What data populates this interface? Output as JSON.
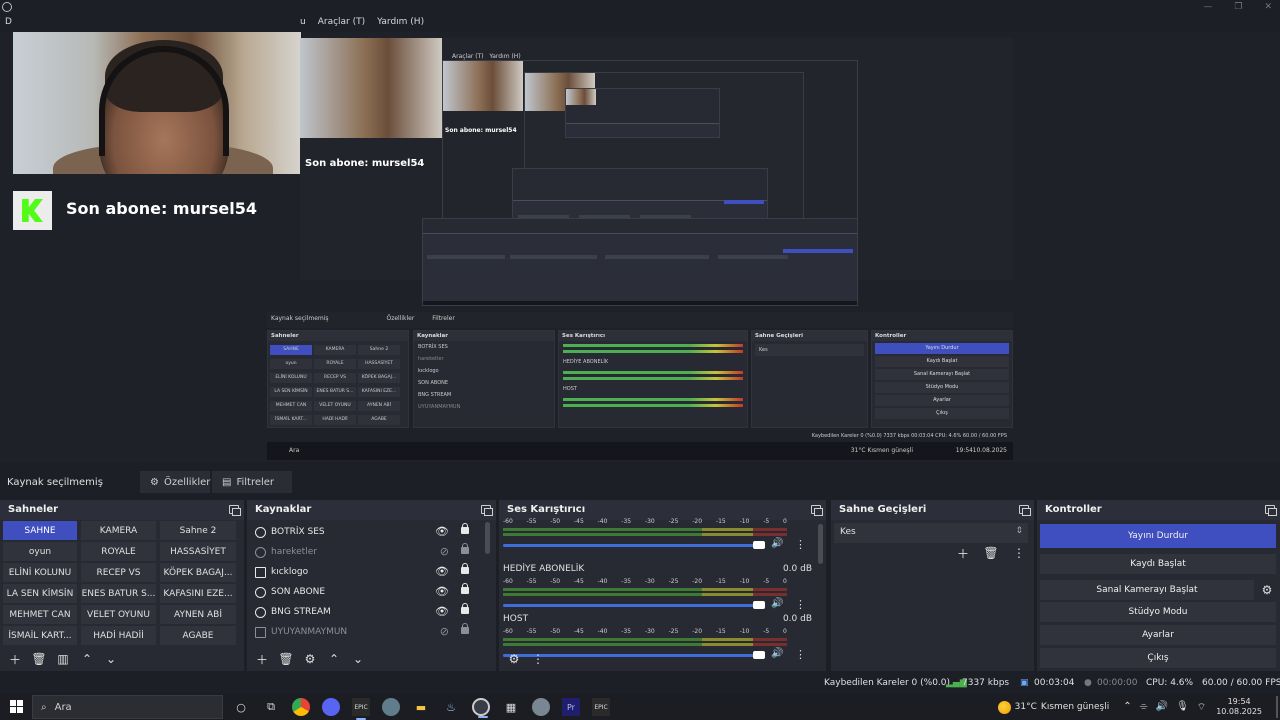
{
  "menu": {
    "left_fragment": "D",
    "fragment_u": "u",
    "items": [
      "Araçlar (T)",
      "Yardım (H)"
    ]
  },
  "preview": {
    "sub_alert": "Son abone: mursel54",
    "nested": {
      "menu_items": [
        "Araçlar (T)",
        "Yardım (H)"
      ],
      "strip_label": "Kaynak seçilmemiş",
      "props": "Özellikler",
      "filters": "Filtreler",
      "panels": {
        "scenes": "Sahneler",
        "sources": "Kaynaklar",
        "mixer": "Ses Karıştırıcı",
        "transitions": "Sahne Geçişleri",
        "controls": "Kontroller"
      },
      "transition": "Kes",
      "channels": [
        "HEDİYE ABONELİK",
        "HOST"
      ],
      "status": "Kaybedilen Kareler 0 (%0.0)   7337 kbps   00:03:04   CPU: 4.6%   60.00 / 60.00 FPS",
      "taskbar_search": "Ara",
      "weather": "31°C  Kısmen güneşli",
      "time": "19:54",
      "date": "10.08.2025"
    }
  },
  "toolbar": {
    "no_source": "Kaynak seçilmemiş",
    "properties": "Özellikler",
    "filters": "Filtreler"
  },
  "scenes": {
    "title": "Sahneler",
    "items": [
      "SAHNE",
      "KAMERA",
      "Sahne 2",
      "oyun",
      "ROYALE",
      "HASSASİYET",
      "ELİNİ KOLUNU",
      "RECEP VS",
      "KÖPEK BAGAJ...",
      "LA SEN KİMSİN",
      "ENES BATUR S...",
      "KAFASINI EZE...",
      "MEHMET CAN",
      "VELET OYUNU",
      "AYNEN ABİ",
      "İSMAİL KART...",
      "HADİ HADİİ",
      "AGABE"
    ],
    "active_index": 0
  },
  "sources": {
    "title": "Kaynaklar",
    "items": [
      {
        "name": "BOTRİX SES",
        "visible": true,
        "dim": false,
        "type": "browser"
      },
      {
        "name": "hareketler",
        "visible": false,
        "dim": true,
        "type": "browser"
      },
      {
        "name": "kıcklogo",
        "visible": true,
        "dim": false,
        "type": "image"
      },
      {
        "name": "SON ABONE",
        "visible": true,
        "dim": false,
        "type": "browser"
      },
      {
        "name": "BNG STREAM",
        "visible": true,
        "dim": false,
        "type": "browser"
      },
      {
        "name": "UYUYANMAYMUN",
        "visible": false,
        "dim": true,
        "type": "image"
      }
    ]
  },
  "mixer": {
    "title": "Ses Karıştırıcı",
    "scale": [
      "-60",
      "-55",
      "-50",
      "-45",
      "-40",
      "-35",
      "-30",
      "-25",
      "-20",
      "-15",
      "-10",
      "-5",
      "0"
    ],
    "channels": [
      {
        "name": "",
        "db": ""
      },
      {
        "name": "HEDİYE ABONELİK",
        "db": "0.0 dB"
      },
      {
        "name": "HOST",
        "db": "0.0 dB"
      }
    ]
  },
  "transitions": {
    "title": "Sahne Geçişleri",
    "selected": "Kes"
  },
  "controls": {
    "title": "Kontroller",
    "stop_stream": "Yayını Durdur",
    "start_record": "Kaydı Başlat",
    "virtual_cam": "Sanal Kamerayı Başlat",
    "studio_mode": "Stüdyo Modu",
    "settings": "Ayarlar",
    "exit": "Çıkış"
  },
  "status": {
    "dropped": "Kaybedilen Kareler 0 (%0.0)",
    "bitrate": "7337 kbps",
    "stream_time": "00:03:04",
    "record_time": "00:00:00",
    "cpu": "CPU: 4.6%",
    "fps": "60.00 / 60.00 FPS"
  },
  "taskbar": {
    "search_placeholder": "Ara",
    "weather_temp": "31°C",
    "weather_text": "Kısmen güneşli",
    "time": "19:54",
    "date": "10.08.2025"
  }
}
